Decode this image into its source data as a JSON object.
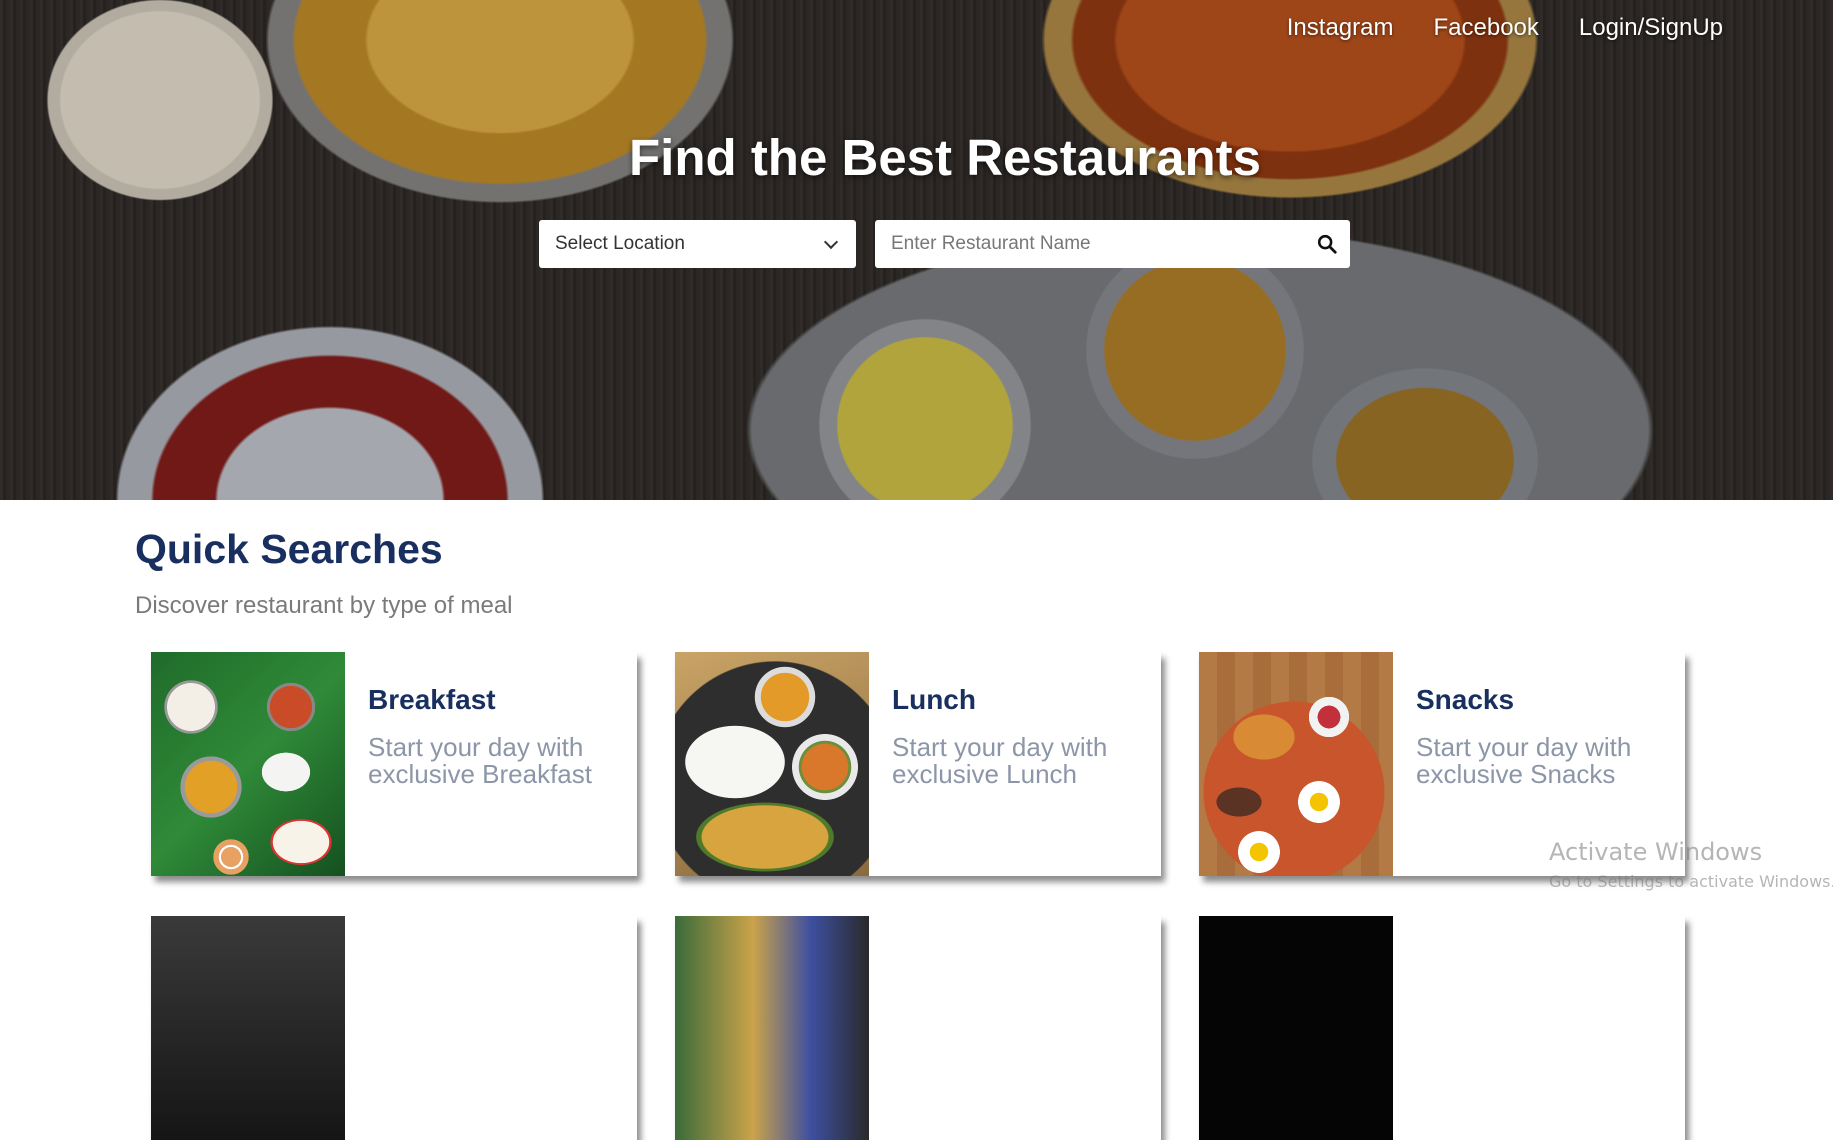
{
  "nav": {
    "instagram": "Instagram",
    "facebook": "Facebook",
    "login": "Login/SignUp"
  },
  "hero": {
    "title": "Find the Best Restaurants",
    "location_select": "Select Location",
    "restaurant_placeholder": "Enter Restaurant Name",
    "search_icon": "search-icon",
    "dropdown_icon": "chevron-down-icon"
  },
  "quick_searches": {
    "title": "Quick Searches",
    "subtitle": "Discover restaurant by type of meal",
    "cards": [
      {
        "title": "Breakfast",
        "description": "Start your day with exclusive Breakfast"
      },
      {
        "title": "Lunch",
        "description": "Start your day with exclusive Lunch"
      },
      {
        "title": "Snacks",
        "description": "Start your day with exclusive Snacks"
      }
    ]
  },
  "watermark": {
    "line1": "Activate Windows",
    "line2": "Go to Settings to activate Windows."
  },
  "colors": {
    "heading": "#192f60",
    "subtitle": "#7a7a7a",
    "card_description": "#8c96a8"
  }
}
